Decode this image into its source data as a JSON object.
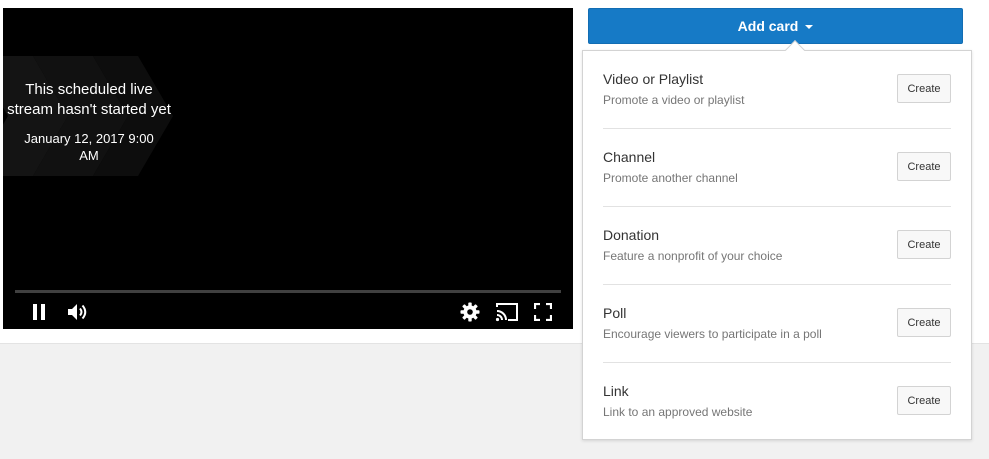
{
  "player": {
    "slate_title": "This scheduled live stream hasn't started yet",
    "slate_date": "January 12, 2017 9:00 AM",
    "icons": [
      "pause-icon",
      "volume-icon",
      "settings-gear-icon",
      "cast-icon",
      "fullscreen-icon"
    ]
  },
  "add_card": {
    "label": "Add card",
    "color": "#167ac6",
    "items": [
      {
        "title": "Video or Playlist",
        "description": "Promote a video or playlist",
        "button": "Create"
      },
      {
        "title": "Channel",
        "description": "Promote another channel",
        "button": "Create"
      },
      {
        "title": "Donation",
        "description": "Feature a nonprofit of your choice",
        "button": "Create"
      },
      {
        "title": "Poll",
        "description": "Encourage viewers to participate in a poll",
        "button": "Create"
      },
      {
        "title": "Link",
        "description": "Link to an approved website",
        "button": "Create"
      }
    ]
  }
}
